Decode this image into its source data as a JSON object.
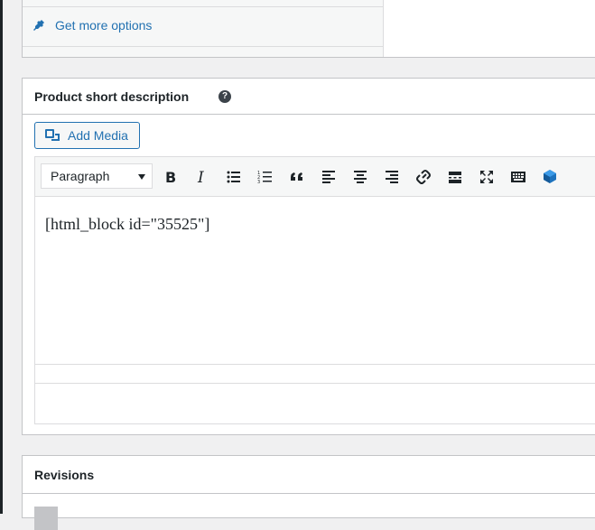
{
  "top_panel": {
    "get_more_label": "Get more options"
  },
  "short_description": {
    "title": "Product short description",
    "help_icon_glyph": "?",
    "add_media_label": "Add Media",
    "format_select_value": "Paragraph",
    "content": "[html_block id=\"35525\"]",
    "toolbar_icons": [
      "bold-icon",
      "italic-icon",
      "bullet-list-icon",
      "numbered-list-icon",
      "blockquote-icon",
      "align-left-icon",
      "align-center-icon",
      "align-right-icon",
      "link-icon",
      "read-more-icon",
      "fullscreen-icon",
      "keyboard-icon",
      "plugin-cube-icon"
    ],
    "accent_color": "#2271b1"
  },
  "revisions": {
    "title": "Revisions"
  }
}
